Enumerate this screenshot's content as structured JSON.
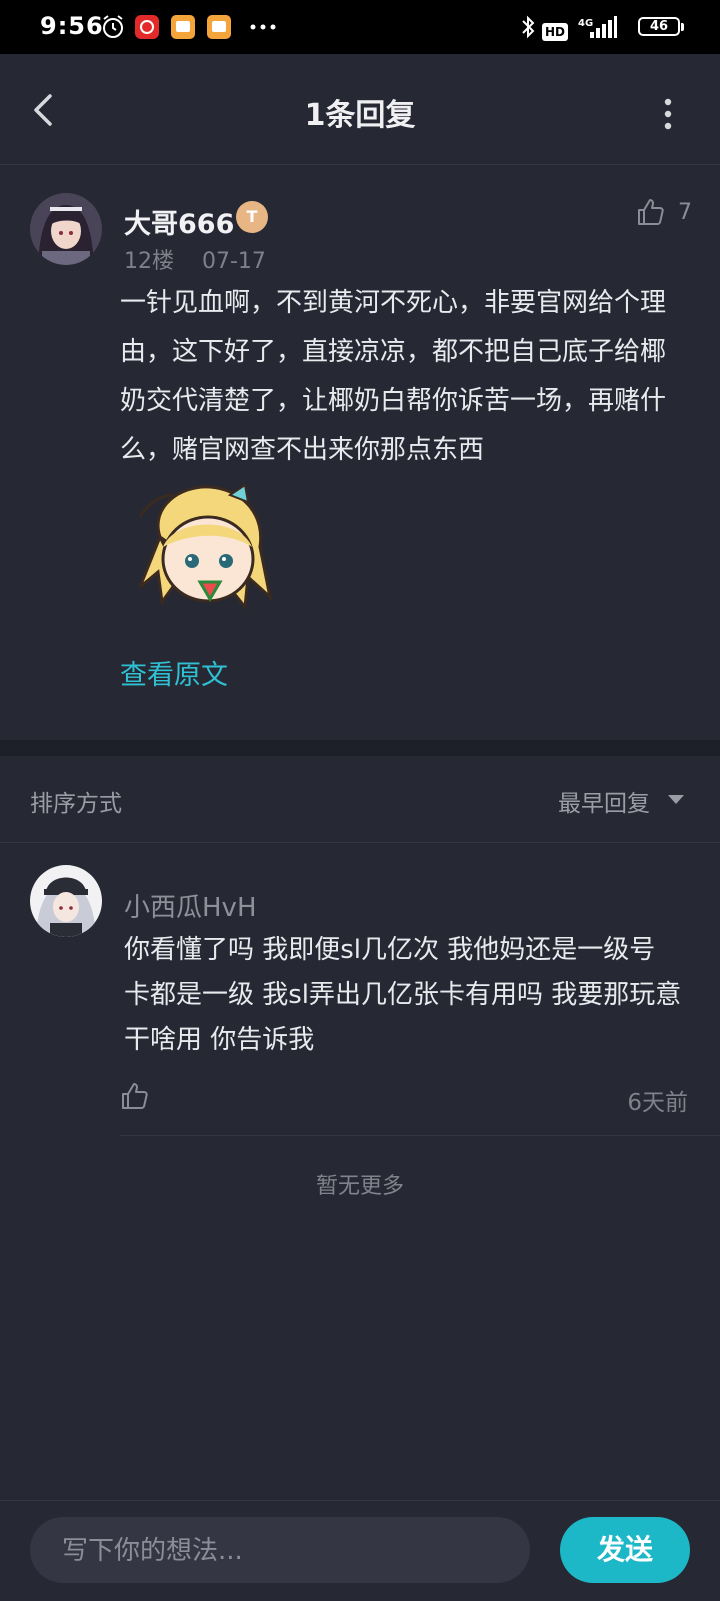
{
  "status_bar": {
    "time": "9:56",
    "network": "4G",
    "hd_label": "HD",
    "battery": "46"
  },
  "header": {
    "title": "1条回复"
  },
  "main_comment": {
    "user_name": "大哥666",
    "level_badge": "T",
    "like_count": "7",
    "floor": "12楼",
    "date": "07-17",
    "text": "一针见血啊，不到黄河不死心，非要官网给个理由，这下好了，直接凉凉，都不把自己底子给椰奶交代清楚了，让椰奶白帮你诉苦一场，再赌什么，赌官网查不出来你那点东西",
    "view_original": "查看原文"
  },
  "sort": {
    "label": "排序方式",
    "value": "最早回复"
  },
  "reply": {
    "user_name": "小西瓜HvH",
    "text": "你看懂了吗 我即便sl几亿次 我他妈还是一级号 卡都是一级 我sl弄出几亿张卡有用吗 我要那玩意干啥用 你告诉我",
    "time": "6天前"
  },
  "footer_note": "暂无更多",
  "composer": {
    "placeholder": "写下你的想法...",
    "send_label": "发送"
  },
  "colors": {
    "background": "#262833",
    "accent": "#1db8c7",
    "link": "#2fc1d3"
  }
}
